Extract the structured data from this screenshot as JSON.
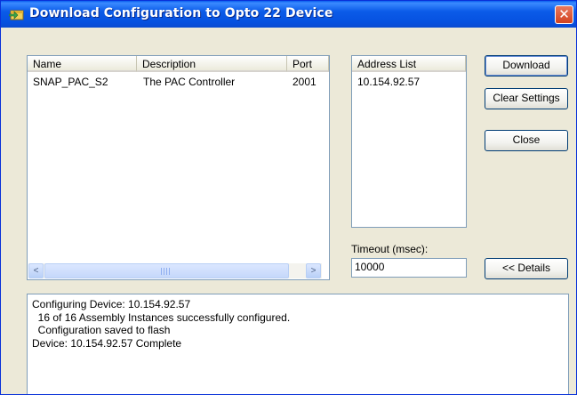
{
  "window": {
    "title": "Download Configuration to Opto 22 Device",
    "close_glyph": "✕"
  },
  "device_list": {
    "columns": [
      "Name",
      "Description",
      "Port"
    ],
    "rows": [
      {
        "name": "SNAP_PAC_S2",
        "description": "The PAC Controller",
        "port": "2001"
      }
    ],
    "scrollbar": {
      "left_arrow": "<",
      "right_arrow": ">"
    }
  },
  "address_list": {
    "header": "Address List",
    "items": [
      "10.154.92.57"
    ]
  },
  "timeout": {
    "label": "Timeout (msec):",
    "value": "10000"
  },
  "buttons": {
    "download": "Download",
    "clear_settings": "Clear Settings",
    "close": "Close",
    "details": "<< Details"
  },
  "log": {
    "lines": [
      "Configuring Device: 10.154.92.57",
      "  16 of 16 Assembly Instances successfully configured.",
      "  Configuration saved to flash",
      "Device: 10.154.92.57 Complete"
    ]
  },
  "icons": {
    "title_icon": "download-device-icon",
    "close_icon": "close-icon"
  }
}
